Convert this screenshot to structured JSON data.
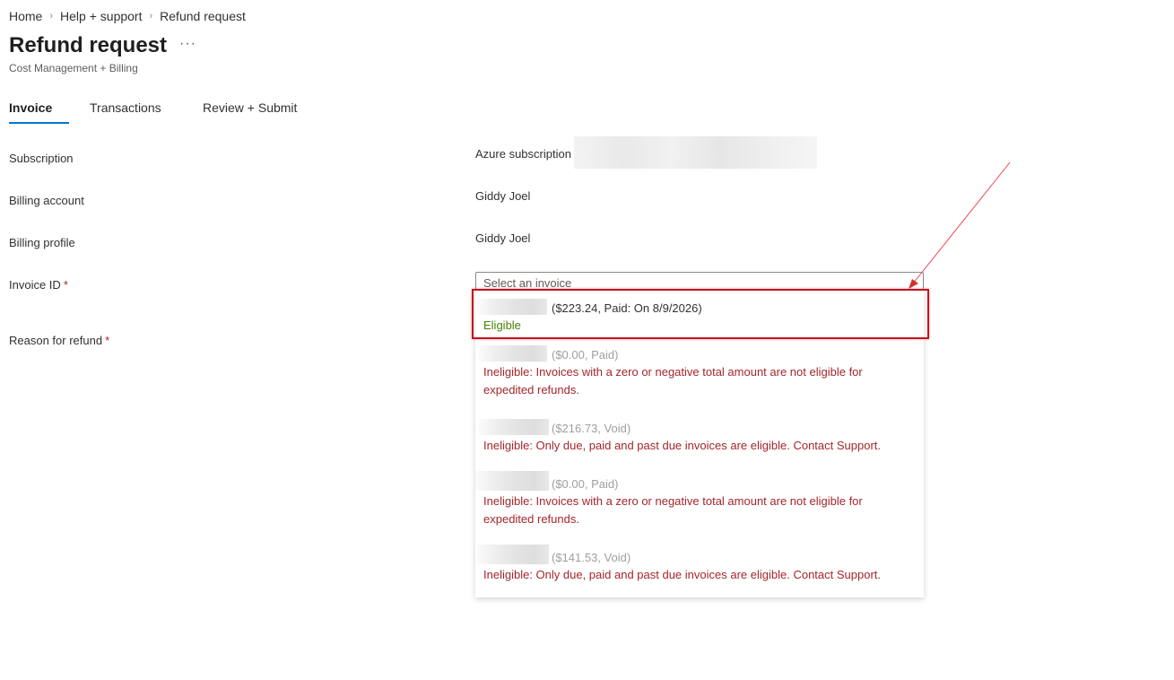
{
  "breadcrumb": [
    "Home",
    "Help + support",
    "Refund request"
  ],
  "header": {
    "title": "Refund request",
    "more_label": "···",
    "subtitle": "Cost Management + Billing"
  },
  "tabs": [
    {
      "label": "Invoice",
      "active": true
    },
    {
      "label": "Transactions",
      "active": false
    },
    {
      "label": "Review + Submit",
      "active": false
    }
  ],
  "form": {
    "subscription": {
      "label": "Subscription",
      "value": "Azure subscription"
    },
    "billing_account": {
      "label": "Billing account",
      "value": "Giddy Joel"
    },
    "billing_profile": {
      "label": "Billing profile",
      "value": "Giddy Joel"
    },
    "invoice_id": {
      "label": "Invoice ID",
      "required_mark": "*",
      "placeholder": "Select an invoice"
    },
    "reason": {
      "label": "Reason for refund",
      "required_mark": "*"
    }
  },
  "invoice_options": [
    {
      "amount": "($223.24, Paid: On 8/9/2026)",
      "status": "Eligible",
      "eligible": true
    },
    {
      "amount": "($0.00, Paid)",
      "status": "Ineligible: Invoices with a zero or negative total amount are not eligible for expedited refunds.",
      "eligible": false
    },
    {
      "amount": "($216.73, Void)",
      "status": "Ineligible: Only due, paid and past due invoices are eligible. Contact Support.",
      "eligible": false
    },
    {
      "amount": "($0.00, Paid)",
      "status": "Ineligible: Invoices with a zero or negative total amount are not eligible for expedited refunds.",
      "eligible": false
    },
    {
      "amount": "($141.53, Void)",
      "status": "Ineligible: Only due, paid and past due invoices are eligible. Contact Support.",
      "eligible": false
    }
  ],
  "colors": {
    "accent": "#0078d4",
    "eligible": "#498205",
    "ineligible": "#a4262c",
    "annotation": "#c50f1f"
  }
}
